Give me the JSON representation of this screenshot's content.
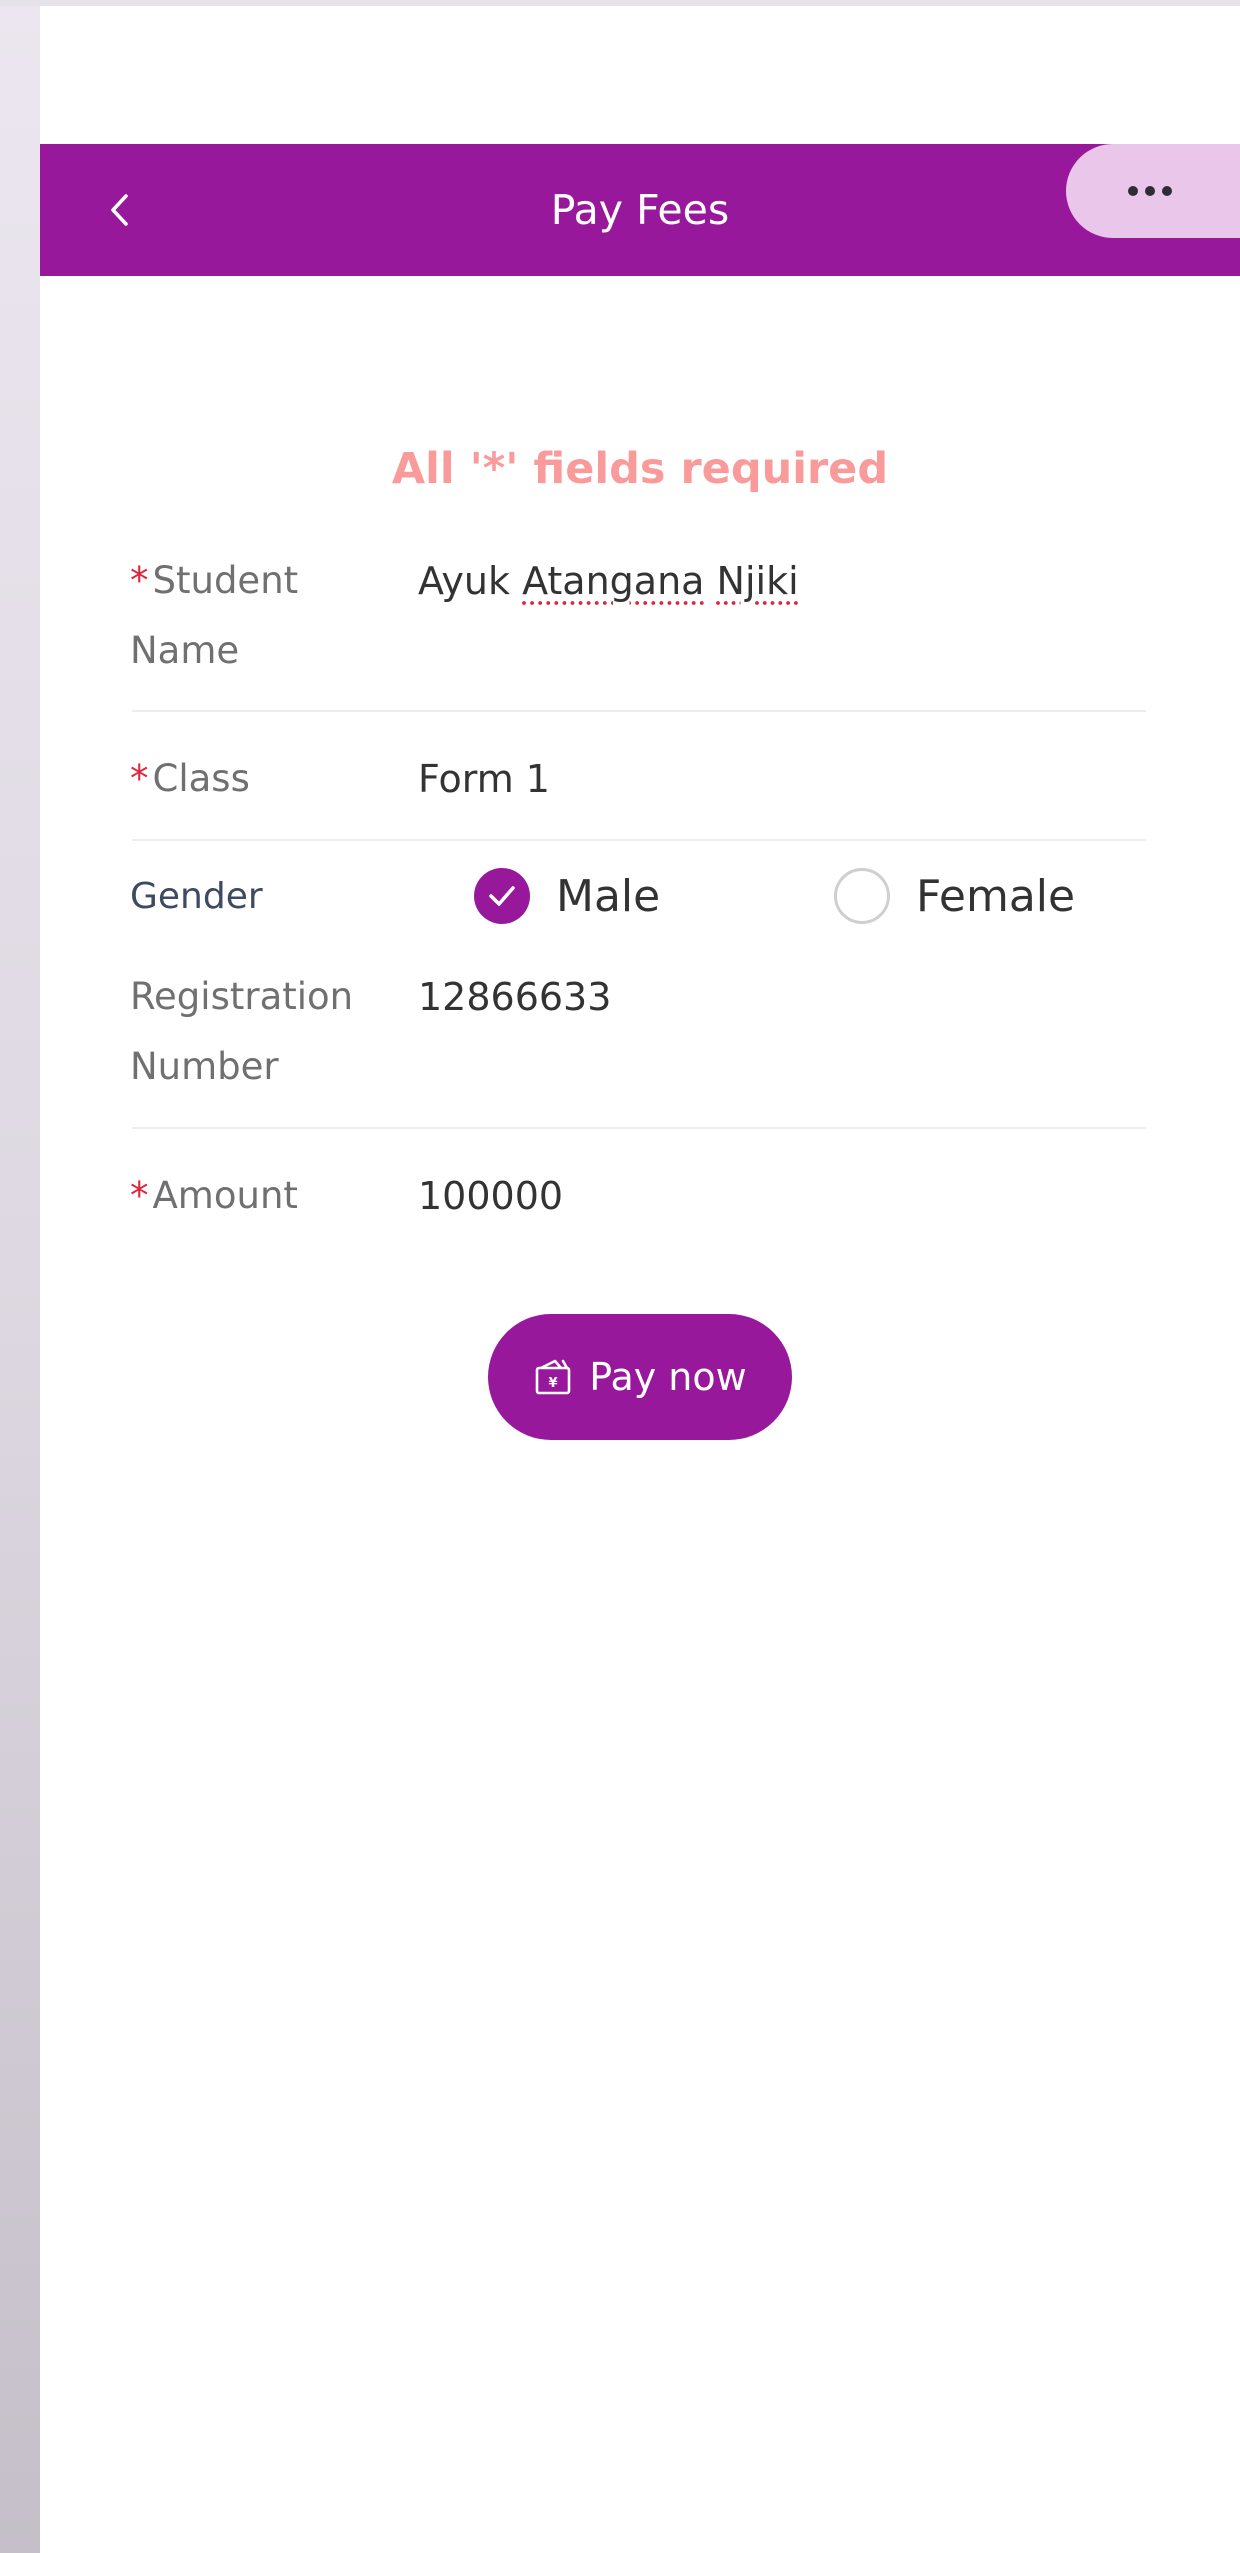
{
  "header": {
    "title": "Pay Fees",
    "back_icon": "chevron-left-icon",
    "more_icon": "more-dots-icon"
  },
  "form": {
    "required_note": "All '*' fields required",
    "required_marker": "*",
    "student_name": {
      "label_line1": "Student",
      "label_line2": "Name",
      "value_parts": [
        "Ayuk ",
        "Atangana",
        " ",
        "Njiki"
      ]
    },
    "class": {
      "label": "Class",
      "value": "Form 1"
    },
    "gender": {
      "label": "Gender",
      "options": [
        {
          "label": "Male",
          "selected": true
        },
        {
          "label": "Female",
          "selected": false
        }
      ]
    },
    "registration": {
      "label_line1": "Registration",
      "label_line2": "Number",
      "value": "12866633"
    },
    "amount": {
      "label": "Amount",
      "value": "100000"
    }
  },
  "pay_button": {
    "label": "Pay now",
    "icon": "wallet-icon"
  },
  "colors": {
    "brand": "#98189c",
    "more_button_bg": "#eac6ea",
    "required_note": "#f99b9b",
    "required_star": "#e0243c"
  }
}
